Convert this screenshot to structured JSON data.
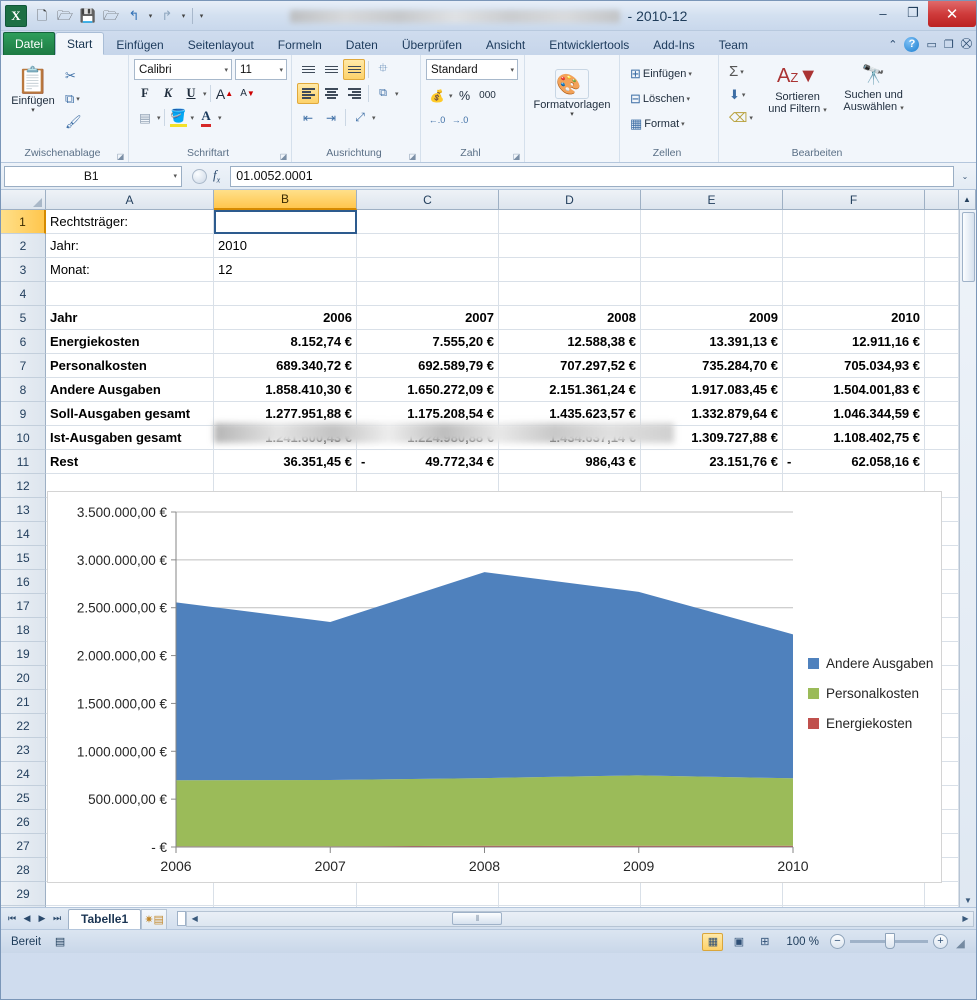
{
  "window": {
    "title_suffix": "- 2010-12",
    "title_redacted": true,
    "minimize": "–",
    "restore": "❐",
    "close": "✕"
  },
  "quick_access": [
    {
      "name": "new-file",
      "glyph": "🗋"
    },
    {
      "name": "open-file",
      "glyph": "🗁"
    },
    {
      "name": "save-file",
      "glyph": "💾"
    },
    {
      "name": "open-recent",
      "glyph": "🗁"
    },
    {
      "name": "undo",
      "glyph": "↰"
    },
    {
      "name": "redo",
      "glyph": "↱"
    },
    {
      "name": "customize",
      "glyph": "⯆"
    }
  ],
  "tabs": [
    {
      "label": "Datei",
      "active": false,
      "file": true
    },
    {
      "label": "Start",
      "active": true,
      "file": false
    },
    {
      "label": "Einfügen",
      "active": false,
      "file": false
    },
    {
      "label": "Seitenlayout",
      "active": false,
      "file": false
    },
    {
      "label": "Formeln",
      "active": false,
      "file": false
    },
    {
      "label": "Daten",
      "active": false,
      "file": false
    },
    {
      "label": "Überprüfen",
      "active": false,
      "file": false
    },
    {
      "label": "Ansicht",
      "active": false,
      "file": false
    },
    {
      "label": "Entwicklertools",
      "active": false,
      "file": false
    },
    {
      "label": "Add-Ins",
      "active": false,
      "file": false
    },
    {
      "label": "Team",
      "active": false,
      "file": false
    }
  ],
  "tab_right_icons": {
    "collapse": "⌃",
    "help": "?",
    "minimize": "▭",
    "restore": "❐",
    "close": "⛒"
  },
  "ribbon": {
    "clipboard": {
      "title": "Zwischenablage",
      "paste_label": "Einfügen",
      "paste_caret": "▾",
      "cut": "✂",
      "copy": "⧉",
      "format_painter": "🖌"
    },
    "font": {
      "title": "Schriftart",
      "font_name": "Calibri",
      "font_size": "11",
      "bold": "F",
      "italic": "K",
      "underline": "U",
      "grow": "A",
      "shrink": "A",
      "borders_caret": "▾",
      "fill_color": "A",
      "font_color": "A"
    },
    "alignment": {
      "title": "Ausrichtung",
      "align_top": "top-align",
      "align_middle": "middle-align",
      "align_bottom": "bottom-align",
      "wrap_text": "wrap-text",
      "align_left": "left-align",
      "align_center": "center-align",
      "align_right": "right-align",
      "merge": "merge-cells",
      "indent_decrease": "indent-decrease",
      "indent_increase": "indent-increase",
      "orientation": "orientation"
    },
    "number": {
      "title": "Zahl",
      "format": "Standard",
      "currency": "💰",
      "percent": "%",
      "thousands": "000",
      "dec_increase": "⁺.0",
      "dec_decrease": "⁻.0"
    },
    "styles": {
      "title": "",
      "label": "Formatvorlagen",
      "caret": "▾"
    },
    "cells": {
      "title": "Zellen",
      "items": [
        {
          "label": "Einfügen",
          "icon": "insert-cells-icon"
        },
        {
          "label": "Löschen",
          "icon": "delete-cells-icon"
        },
        {
          "label": "Format",
          "icon": "format-cells-icon"
        }
      ]
    },
    "editing": {
      "title": "Bearbeiten",
      "autosum": "Σ",
      "fill": "⬇",
      "clear": "⌫",
      "sort_label_1": "Sortieren",
      "sort_label_2": "und Filtern",
      "find_label_1": "Suchen und",
      "find_label_2": "Auswählen"
    }
  },
  "formula_bar": {
    "name_box": "B1",
    "name_caret": "▾",
    "fx": "fx",
    "value": "01.0052.0001",
    "expand_caret": "⌄"
  },
  "grid": {
    "columns": [
      "A",
      "B",
      "C",
      "D",
      "E",
      "F"
    ],
    "selected_column": "B",
    "selected_cell": "B1",
    "rows": [
      {
        "n": "1",
        "cells": [
          "Rechtsträger:",
          "",
          "",
          "",
          "",
          ""
        ],
        "bold": false,
        "redacted_b": true
      },
      {
        "n": "2",
        "cells": [
          "Jahr:",
          "2010",
          "",
          "",
          "",
          ""
        ],
        "bold": false
      },
      {
        "n": "3",
        "cells": [
          "Monat:",
          "12",
          "",
          "",
          "",
          ""
        ],
        "bold": false
      },
      {
        "n": "4",
        "cells": [
          "",
          "",
          "",
          "",
          "",
          ""
        ],
        "bold": false
      },
      {
        "n": "5",
        "cells": [
          "Jahr",
          "2006",
          "2007",
          "2008",
          "2009",
          "2010"
        ],
        "bold": true,
        "num": true
      },
      {
        "n": "6",
        "cells": [
          "Energiekosten",
          "8.152,74 €",
          "7.555,20 €",
          "12.588,38 €",
          "13.391,13 €",
          "12.911,16 €"
        ],
        "bold": true,
        "num": true
      },
      {
        "n": "7",
        "cells": [
          "Personalkosten",
          "689.340,72 €",
          "692.589,79 €",
          "707.297,52 €",
          "735.284,70 €",
          "705.034,93 €"
        ],
        "bold": true,
        "num": true
      },
      {
        "n": "8",
        "cells": [
          "Andere Ausgaben",
          "1.858.410,30 €",
          "1.650.272,09 €",
          "2.151.361,24 €",
          "1.917.083,45 €",
          "1.504.001,83 €"
        ],
        "bold": true,
        "num": true
      },
      {
        "n": "9",
        "cells": [
          "Soll-Ausgaben gesamt",
          "1.277.951,88 €",
          "1.175.208,54 €",
          "1.435.623,57 €",
          "1.332.879,64 €",
          "1.046.344,59 €"
        ],
        "bold": true,
        "num": true
      },
      {
        "n": "10",
        "cells": [
          "Ist-Ausgaben gesamt",
          "1.241.600,43 €",
          "1.224.980,88 €",
          "1.434.637,14 €",
          "1.309.727,88 €",
          "1.108.402,75 €"
        ],
        "bold": true,
        "num": true
      },
      {
        "n": "11",
        "cells": [
          "Rest",
          "36.351,45 €",
          "49.772,34 €",
          "986,43 €",
          "23.151,76 €",
          "62.058,16 €"
        ],
        "bold": true,
        "num": true,
        "negatives": [
          false,
          false,
          true,
          false,
          false,
          true
        ]
      },
      {
        "n": "12",
        "cells": [
          "",
          "",
          "",
          "",
          "",
          ""
        ],
        "bold": false
      },
      {
        "n": "13",
        "cells": [
          "",
          "",
          "",
          "",
          "",
          ""
        ],
        "bold": false
      },
      {
        "n": "14",
        "cells": [
          "",
          "",
          "",
          "",
          "",
          ""
        ],
        "bold": false
      },
      {
        "n": "15",
        "cells": [
          "",
          "",
          "",
          "",
          "",
          ""
        ],
        "bold": false
      },
      {
        "n": "16",
        "cells": [
          "",
          "",
          "",
          "",
          "",
          ""
        ],
        "bold": false
      },
      {
        "n": "17",
        "cells": [
          "",
          "",
          "",
          "",
          "",
          ""
        ],
        "bold": false
      },
      {
        "n": "18",
        "cells": [
          "",
          "",
          "",
          "",
          "",
          ""
        ],
        "bold": false
      },
      {
        "n": "19",
        "cells": [
          "",
          "",
          "",
          "",
          "",
          ""
        ],
        "bold": false
      },
      {
        "n": "20",
        "cells": [
          "",
          "",
          "",
          "",
          "",
          ""
        ],
        "bold": false
      },
      {
        "n": "21",
        "cells": [
          "",
          "",
          "",
          "",
          "",
          ""
        ],
        "bold": false
      },
      {
        "n": "22",
        "cells": [
          "",
          "",
          "",
          "",
          "",
          ""
        ],
        "bold": false
      },
      {
        "n": "23",
        "cells": [
          "",
          "",
          "",
          "",
          "",
          ""
        ],
        "bold": false
      },
      {
        "n": "24",
        "cells": [
          "",
          "",
          "",
          "",
          "",
          ""
        ],
        "bold": false
      },
      {
        "n": "25",
        "cells": [
          "",
          "",
          "",
          "",
          "",
          ""
        ],
        "bold": false
      },
      {
        "n": "26",
        "cells": [
          "",
          "",
          "",
          "",
          "",
          ""
        ],
        "bold": false
      },
      {
        "n": "27",
        "cells": [
          "",
          "",
          "",
          "",
          "",
          ""
        ],
        "bold": false
      },
      {
        "n": "28",
        "cells": [
          "",
          "",
          "",
          "",
          "",
          ""
        ],
        "bold": false
      },
      {
        "n": "29",
        "cells": [
          "",
          "",
          "",
          "",
          "",
          ""
        ],
        "bold": false
      },
      {
        "n": "30",
        "cells": [
          "",
          "",
          "",
          "",
          "",
          ""
        ],
        "bold": false
      }
    ]
  },
  "chart_data": {
    "type": "area",
    "stacked": true,
    "title": "",
    "xlabel": "",
    "ylabel": "",
    "categories": [
      "2006",
      "2007",
      "2008",
      "2009",
      "2010"
    ],
    "series": [
      {
        "name": "Energiekosten",
        "color": "#C0504D",
        "values": [
          8152.74,
          7555.2,
          12588.38,
          13391.13,
          12911.16
        ]
      },
      {
        "name": "Personalkosten",
        "color": "#9BBB59",
        "values": [
          689340.72,
          692589.79,
          707297.52,
          735284.7,
          705034.93
        ]
      },
      {
        "name": "Andere Ausgaben",
        "color": "#4F81BD",
        "values": [
          1858410.3,
          1650272.09,
          2151361.24,
          1917083.45,
          1504001.83
        ]
      }
    ],
    "legend_order": [
      "Andere Ausgaben",
      "Personalkosten",
      "Energiekosten"
    ],
    "legend_position": "right",
    "ylim": [
      0,
      3500000
    ],
    "ytick_values": [
      0,
      500000,
      1000000,
      1500000,
      2000000,
      2500000,
      3000000,
      3500000
    ],
    "ytick_labels": [
      "- €",
      "500.000,00 €",
      "1.000.000,00 €",
      "1.500.000,00 €",
      "2.000.000,00 €",
      "2.500.000,00 €",
      "3.000.000,00 €",
      "3.500.000,00 €"
    ],
    "grid": true
  },
  "sheet_tabs": {
    "first": "⏮",
    "prev": "◀",
    "next": "▶",
    "last": "⏭",
    "tabs": [
      {
        "label": "Tabelle1",
        "active": true
      }
    ],
    "new_sheet_icon": "new-sheet-icon"
  },
  "scrollbar": {
    "left_arrow": "◀",
    "right_arrow": "▶",
    "thumb": "⦀"
  },
  "status_bar": {
    "state": "Bereit",
    "macro_icon": "record-macro-icon",
    "views": [
      {
        "name": "normal-view",
        "glyph": "▦",
        "active": true
      },
      {
        "name": "page-layout-view",
        "glyph": "▣",
        "active": false
      },
      {
        "name": "page-break-view",
        "glyph": "⊞",
        "active": false
      }
    ],
    "zoom_level": "100 %",
    "zoom_out": "−",
    "zoom_in": "+"
  }
}
